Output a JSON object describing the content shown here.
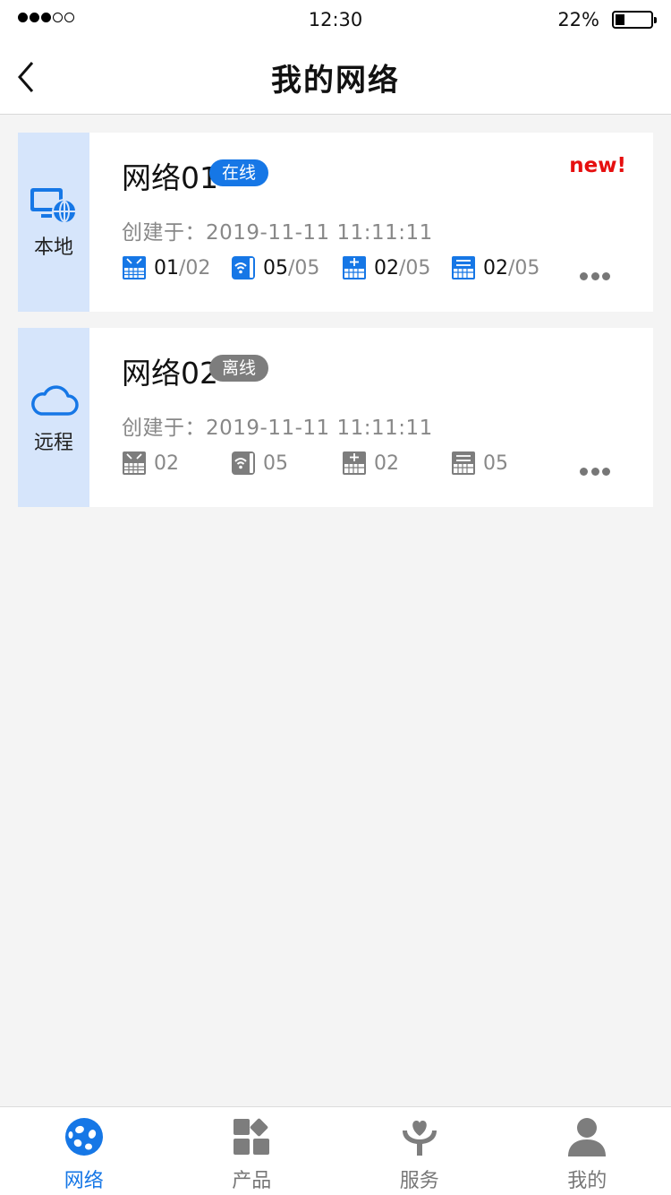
{
  "status_bar": {
    "time": "12:30",
    "battery_percent": "22%",
    "battery_level": 0.22,
    "signal_bars_filled": 3,
    "signal_bars_total": 5
  },
  "nav": {
    "title": "我的网络",
    "back_icon": "chevron-left-icon"
  },
  "colors": {
    "accent": "#1677e6",
    "offline_gray": "#7d7d7d",
    "new_red": "#e60f0f",
    "side_bg": "#d6e5fb"
  },
  "networks": [
    {
      "side_icon": "local-network-icon",
      "side_label": "本地",
      "name": "网络01",
      "status": "在线",
      "new_tag": "new!",
      "created": "创建于：2019-11-11 11:11:11",
      "stats": [
        {
          "icon": "router-icon",
          "current": "01",
          "total": "/02"
        },
        {
          "icon": "wifi-ap-icon",
          "current": "05",
          "total": "/05"
        },
        {
          "icon": "gateway-icon",
          "current": "02",
          "total": "/05"
        },
        {
          "icon": "switch-icon",
          "current": "02",
          "total": "/05"
        }
      ]
    },
    {
      "side_icon": "cloud-icon",
      "side_label": "远程",
      "name": "网络02",
      "status": "离线",
      "created": "创建于：2019-11-11 11:11:11",
      "stats": [
        {
          "icon": "router-icon",
          "count": "02"
        },
        {
          "icon": "wifi-ap-icon",
          "count": "05"
        },
        {
          "icon": "gateway-icon",
          "count": "02"
        },
        {
          "icon": "switch-icon",
          "count": "05"
        }
      ]
    }
  ],
  "tabs": [
    {
      "label": "网络",
      "icon": "network-ball-icon",
      "active": true
    },
    {
      "label": "产品",
      "icon": "product-grid-icon",
      "active": false
    },
    {
      "label": "服务",
      "icon": "service-heart-icon",
      "active": false
    },
    {
      "label": "我的",
      "icon": "user-icon",
      "active": false
    }
  ]
}
